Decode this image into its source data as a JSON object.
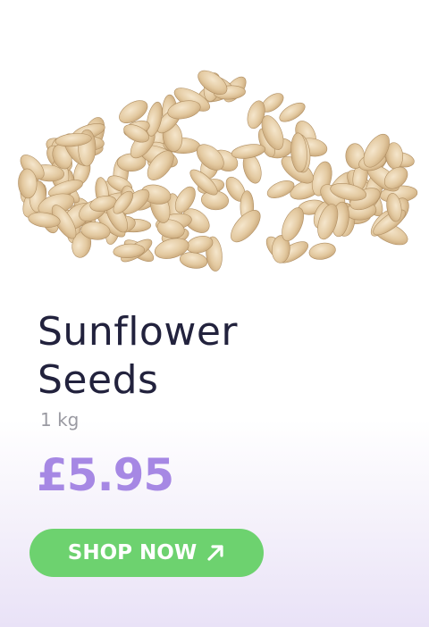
{
  "product": {
    "title_line1": "Sunflower",
    "title_line2": "Seeds",
    "weight": "1 kg",
    "price": "£5.95"
  },
  "cta": {
    "label": "SHOP NOW",
    "icon": "arrow-up-right-icon"
  },
  "image": {
    "subject": "sunflower-seeds-pile"
  },
  "colors": {
    "title": "#22223d",
    "price": "#a688e4",
    "button": "#6dd26f",
    "muted": "#9a9aa2"
  }
}
